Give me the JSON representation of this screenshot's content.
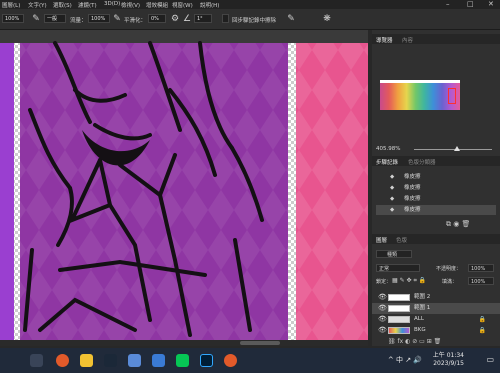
{
  "menubar": {
    "items": [
      "圖層(L)",
      "文字(Y)",
      "選取(S)",
      "濾鏡(T)",
      "3D(D)",
      "檢視(V)",
      "增效模組",
      "視窗(W)",
      "說明(H)"
    ],
    "window_controls": [
      "–",
      "□",
      "✕"
    ]
  },
  "options": {
    "size_value": "100%",
    "mode_value": "一般",
    "flow_label": "流量：",
    "flow_value": "100%",
    "smoothing_label": "平滑化：",
    "smoothing_value": "0%",
    "angle_value": "1°",
    "erase_history_label": "回步驟記錄中擦除"
  },
  "panels": {
    "navigator_tabs": [
      "導覽器",
      "內容"
    ],
    "zoom_value": "405.98%",
    "history_tabs": [
      "步驟記錄",
      "色版分類器"
    ],
    "history_items": [
      "橡皮擦",
      "橡皮擦",
      "橡皮擦",
      "橡皮擦"
    ],
    "layers_tabs": [
      "圖層",
      "色版"
    ],
    "filter_label": "種類",
    "blend_mode": "正常",
    "opacity_label": "不透明度：",
    "opacity_value": "100%",
    "lock_label": "鎖定：",
    "fill_label": "填滿：",
    "fill_value": "100%",
    "layers": [
      {
        "name": "範圍 2",
        "locked": false
      },
      {
        "name": "範圍 1",
        "locked": false
      },
      {
        "name": "ALL",
        "locked": true
      },
      {
        "name": "BKG",
        "locked": true
      }
    ]
  },
  "taskbar": {
    "clock_time": "上午 01:34",
    "clock_date": "2023/9/15",
    "tray_text": "^ 中 ↗ 🔊"
  },
  "colors": {
    "purple": "#8f36a3",
    "pink": "#e8558f",
    "accent": "#2b74d8"
  }
}
